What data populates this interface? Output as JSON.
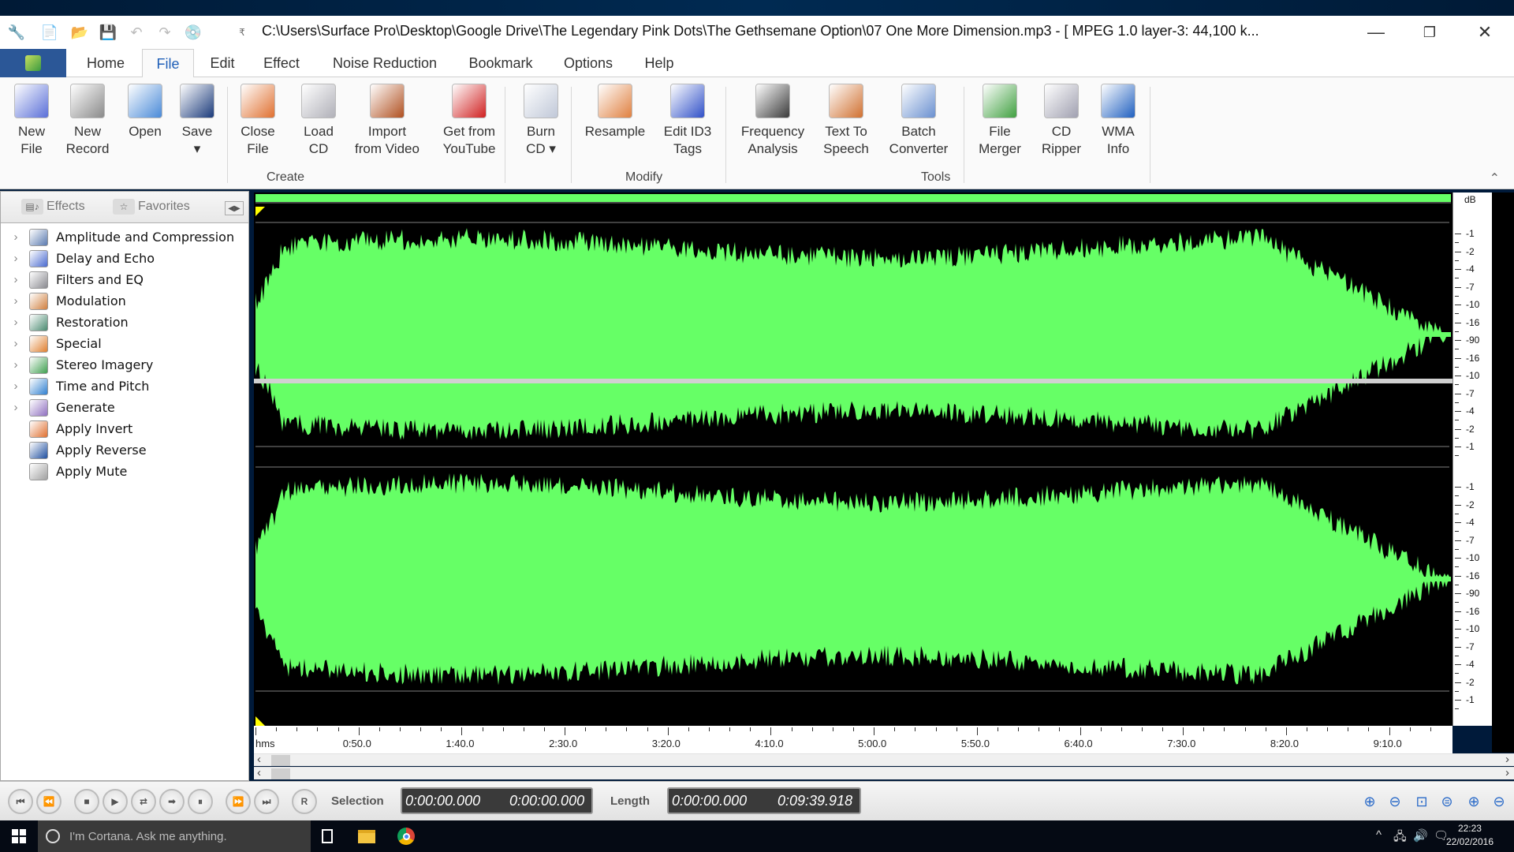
{
  "window": {
    "title": "C:\\Users\\Surface Pro\\Desktop\\Google Drive\\The Legendary Pink Dots\\The Gethsemane Option\\07 One More Dimension.mp3 - [ MPEG 1.0 layer-3: 44,100 k...",
    "controls": {
      "minimize": "—",
      "restore": "❐",
      "close": "✕"
    }
  },
  "quick_access": [
    {
      "name": "app-icon",
      "glyph": "🔧"
    },
    {
      "name": "new-file-icon",
      "glyph": "📄"
    },
    {
      "name": "open-icon",
      "glyph": "📂"
    },
    {
      "name": "save-icon",
      "glyph": "💾"
    },
    {
      "name": "undo-icon",
      "glyph": "↶"
    },
    {
      "name": "redo-icon",
      "glyph": "↷"
    },
    {
      "name": "burn-cd-icon",
      "glyph": "💿"
    },
    {
      "name": "customize-icon",
      "glyph": "₹"
    }
  ],
  "tabs": [
    {
      "label": "Home",
      "active": false
    },
    {
      "label": "File",
      "active": true
    },
    {
      "label": "Edit",
      "active": false
    },
    {
      "label": "Effect",
      "active": false
    },
    {
      "label": "Noise Reduction",
      "active": false
    },
    {
      "label": "Bookmark",
      "active": false
    },
    {
      "label": "Options",
      "active": false
    },
    {
      "label": "Help",
      "active": false
    }
  ],
  "ribbon": {
    "groups": [
      {
        "label": "Create"
      },
      {
        "label": "Modify"
      },
      {
        "label": "Tools"
      }
    ],
    "buttons": [
      {
        "line1": "New",
        "line2": "File",
        "icon": "new-file-icon",
        "color": "#5a6fd8"
      },
      {
        "line1": "New",
        "line2": "Record",
        "icon": "microphone-icon",
        "color": "#8a8a8a"
      },
      {
        "line1": "Open",
        "line2": "",
        "icon": "open-folder-icon",
        "color": "#4a8ad8"
      },
      {
        "line1": "Save",
        "line2": "▾",
        "icon": "floppy-icon",
        "color": "#1a3a7a"
      },
      {
        "line1": "Close",
        "line2": "File",
        "icon": "power-icon",
        "color": "#e07030"
      },
      {
        "line1": "Load",
        "line2": "CD",
        "icon": "cd-drive-icon",
        "color": "#b0b0b8"
      },
      {
        "line1": "Import",
        "line2": "from Video",
        "icon": "film-icon",
        "color": "#b05020"
      },
      {
        "line1": "Get from",
        "line2": "YouTube",
        "icon": "youtube-icon",
        "color": "#d02020"
      },
      {
        "line1": "Burn",
        "line2": "CD ▾",
        "icon": "burn-cd-icon",
        "color": "#c0c8d8"
      },
      {
        "line1": "Resample",
        "line2": "",
        "icon": "resample-icon",
        "color": "#e08040"
      },
      {
        "line1": "Edit ID3",
        "line2": "Tags",
        "icon": "edit-tags-icon",
        "color": "#3050c8"
      },
      {
        "line1": "Frequency",
        "line2": "Analysis",
        "icon": "frequency-icon",
        "color": "#3a3a3a"
      },
      {
        "line1": "Text To",
        "line2": "Speech",
        "icon": "text-to-speech-icon",
        "color": "#d07030"
      },
      {
        "line1": "Batch",
        "line2": "Converter",
        "icon": "batch-icon",
        "color": "#6a90d0"
      },
      {
        "line1": "File",
        "line2": "Merger",
        "icon": "file-merger-icon",
        "color": "#40a040"
      },
      {
        "line1": "CD",
        "line2": "Ripper",
        "icon": "cd-ripper-icon",
        "color": "#a0a0b0"
      },
      {
        "line1": "WMA",
        "line2": "Info",
        "icon": "wma-info-icon",
        "color": "#2060c0"
      }
    ],
    "collapse_glyph": "⌃"
  },
  "left_panel": {
    "tabs": [
      {
        "label": "Effects",
        "glyph": "▤♪"
      },
      {
        "label": "Favorites",
        "glyph": "☆"
      }
    ],
    "toggle_glyph": "◀▶",
    "items": [
      {
        "label": "Amplitude and Compression",
        "expandable": true,
        "icon": "amplitude-icon",
        "color": "#5a7ab0"
      },
      {
        "label": "Delay and Echo",
        "expandable": true,
        "icon": "clock-icon",
        "color": "#4a6ad0"
      },
      {
        "label": "Filters and EQ",
        "expandable": true,
        "icon": "equalizer-icon",
        "color": "#8a8a90"
      },
      {
        "label": "Modulation",
        "expandable": true,
        "icon": "people-icon",
        "color": "#d08040"
      },
      {
        "label": "Restoration",
        "expandable": true,
        "icon": "restoration-icon",
        "color": "#4a8a70"
      },
      {
        "label": "Special",
        "expandable": true,
        "icon": "special-icon",
        "color": "#e08030"
      },
      {
        "label": "Stereo Imagery",
        "expandable": true,
        "icon": "stereo-icon",
        "color": "#40a050"
      },
      {
        "label": "Time and Pitch",
        "expandable": true,
        "icon": "time-pitch-icon",
        "color": "#3080d0"
      },
      {
        "label": "Generate",
        "expandable": true,
        "icon": "generate-icon",
        "color": "#9070c0"
      },
      {
        "label": "Apply Invert",
        "expandable": false,
        "icon": "invert-icon",
        "color": "#e07030"
      },
      {
        "label": "Apply Reverse",
        "expandable": false,
        "icon": "reverse-icon",
        "color": "#2050a0"
      },
      {
        "label": "Apply Mute",
        "expandable": false,
        "icon": "mute-icon",
        "color": "#a0a0a0"
      }
    ]
  },
  "waveform": {
    "color": "#66ff66",
    "background": "#000000",
    "channels": 2,
    "db_unit": "dB",
    "db_labels": [
      "-1",
      "-2",
      "-4",
      "-7",
      "-10",
      "-16",
      "-90",
      "-16",
      "-10",
      "-7",
      "-4",
      "-2",
      "-1"
    ],
    "time_unit": "hms",
    "time_labels": [
      "0:50.0",
      "1:40.0",
      "2:30.0",
      "3:20.0",
      "4:10.0",
      "5:00.0",
      "5:50.0",
      "6:40.0",
      "7:30.0",
      "8:20.0",
      "9:10.0"
    ]
  },
  "transport": {
    "buttons": [
      {
        "name": "go-to-start",
        "glyph": "⏮"
      },
      {
        "name": "rewind",
        "glyph": "⏪"
      },
      {
        "name": "stop",
        "glyph": "■"
      },
      {
        "name": "play",
        "glyph": "▶"
      },
      {
        "name": "loop",
        "glyph": "⇄"
      },
      {
        "name": "play-selection",
        "glyph": "➡"
      },
      {
        "name": "pause",
        "glyph": "⏸"
      },
      {
        "name": "fast-forward",
        "glyph": "⏩"
      },
      {
        "name": "go-to-end",
        "glyph": "⏭"
      },
      {
        "name": "record",
        "glyph": "R"
      }
    ],
    "selection_label": "Selection",
    "selection_start": "0:00:00.000",
    "selection_end": "0:00:00.000",
    "length_label": "Length",
    "length_start": "0:00:00.000",
    "length_end": "0:09:39.918",
    "zoom_buttons": [
      {
        "name": "zoom-in-horizontal",
        "glyph": "⊕"
      },
      {
        "name": "zoom-out-horizontal",
        "glyph": "⊖"
      },
      {
        "name": "zoom-selection",
        "glyph": "⊡"
      },
      {
        "name": "zoom-full",
        "glyph": "⊜"
      },
      {
        "name": "zoom-in-vertical",
        "glyph": "⊕"
      },
      {
        "name": "zoom-out-vertical",
        "glyph": "⊖"
      }
    ]
  },
  "taskbar": {
    "cortana_placeholder": "I'm Cortana. Ask me anything.",
    "time": "22:23",
    "date": "22/02/2016",
    "tray": [
      "^",
      "🖧",
      "🔊",
      "🗨"
    ]
  }
}
